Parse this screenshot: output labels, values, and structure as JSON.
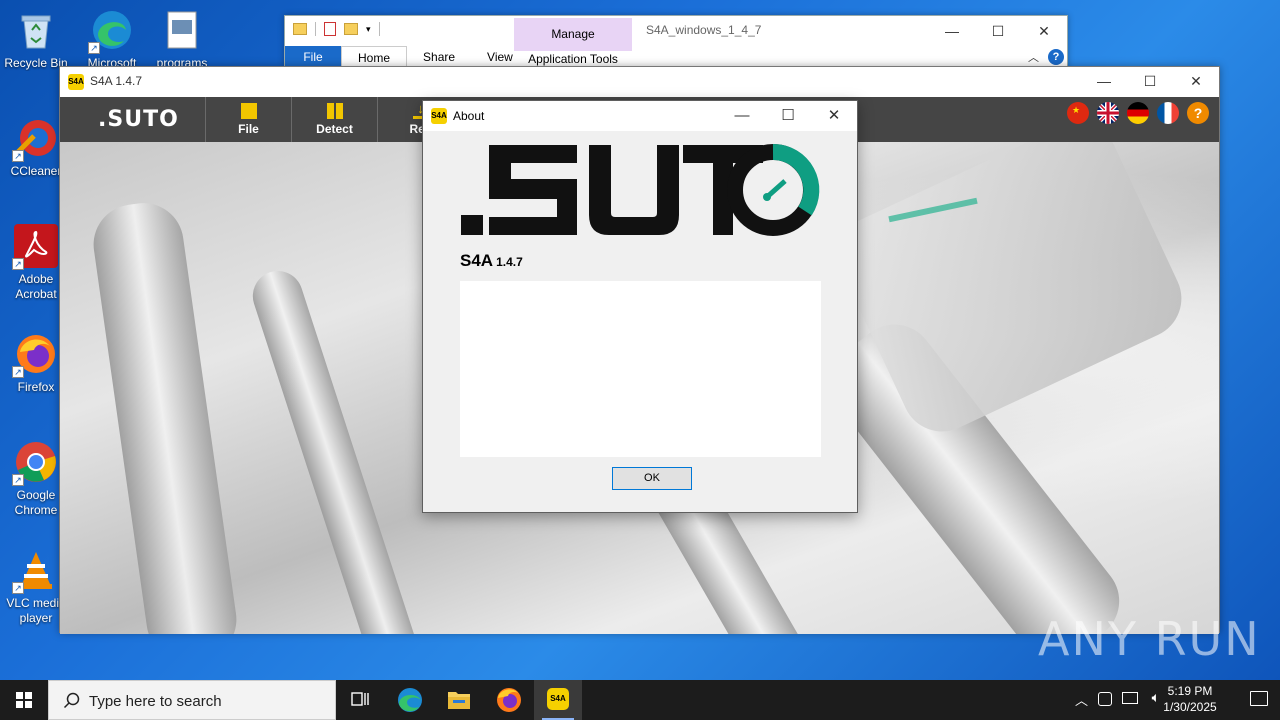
{
  "desktop": {
    "icons": [
      {
        "label": "Recycle Bin",
        "icon": "recycle-bin-icon"
      },
      {
        "label": "Microsoft",
        "icon": "edge-icon"
      },
      {
        "label": "programs",
        "icon": "file-icon"
      },
      {
        "label": "CCleaner",
        "icon": "ccleaner-icon"
      },
      {
        "label": "Adobe Acrobat",
        "icon": "acrobat-icon"
      },
      {
        "label": "Firefox",
        "icon": "firefox-icon"
      },
      {
        "label": "Google Chrome",
        "icon": "chrome-icon"
      },
      {
        "label": "VLC media player",
        "icon": "vlc-icon"
      }
    ]
  },
  "explorer": {
    "manage_label": "Manage",
    "app_tools_label": "Application Tools",
    "title": "S4A_windows_1_4_7",
    "tabs": [
      "File",
      "Home",
      "Share",
      "View"
    ]
  },
  "s4a": {
    "title_name": "S4A",
    "title_version": "1.4.7",
    "logo_text": ".SUTO",
    "toolbar": [
      {
        "label": "File",
        "icon": "file-icon"
      },
      {
        "label": "Detect",
        "icon": "detect-icon"
      },
      {
        "label": "Rea",
        "icon": "read-icon"
      }
    ],
    "languages": [
      "zh",
      "en",
      "de",
      "fr"
    ],
    "help_label": "?"
  },
  "about": {
    "title": "About",
    "product_name": "S4A",
    "version": "1.4.7",
    "text_value": "",
    "ok_label": "OK"
  },
  "watermark": "ANY RUN",
  "taskbar": {
    "search_placeholder": "Type here to search",
    "time": "5:19 PM",
    "date": "1/30/2025"
  },
  "colors": {
    "suto_teal": "#0f9e82",
    "suto_black": "#111111",
    "toolbar_bg": "#454545",
    "accent_yellow": "#f2c600"
  }
}
